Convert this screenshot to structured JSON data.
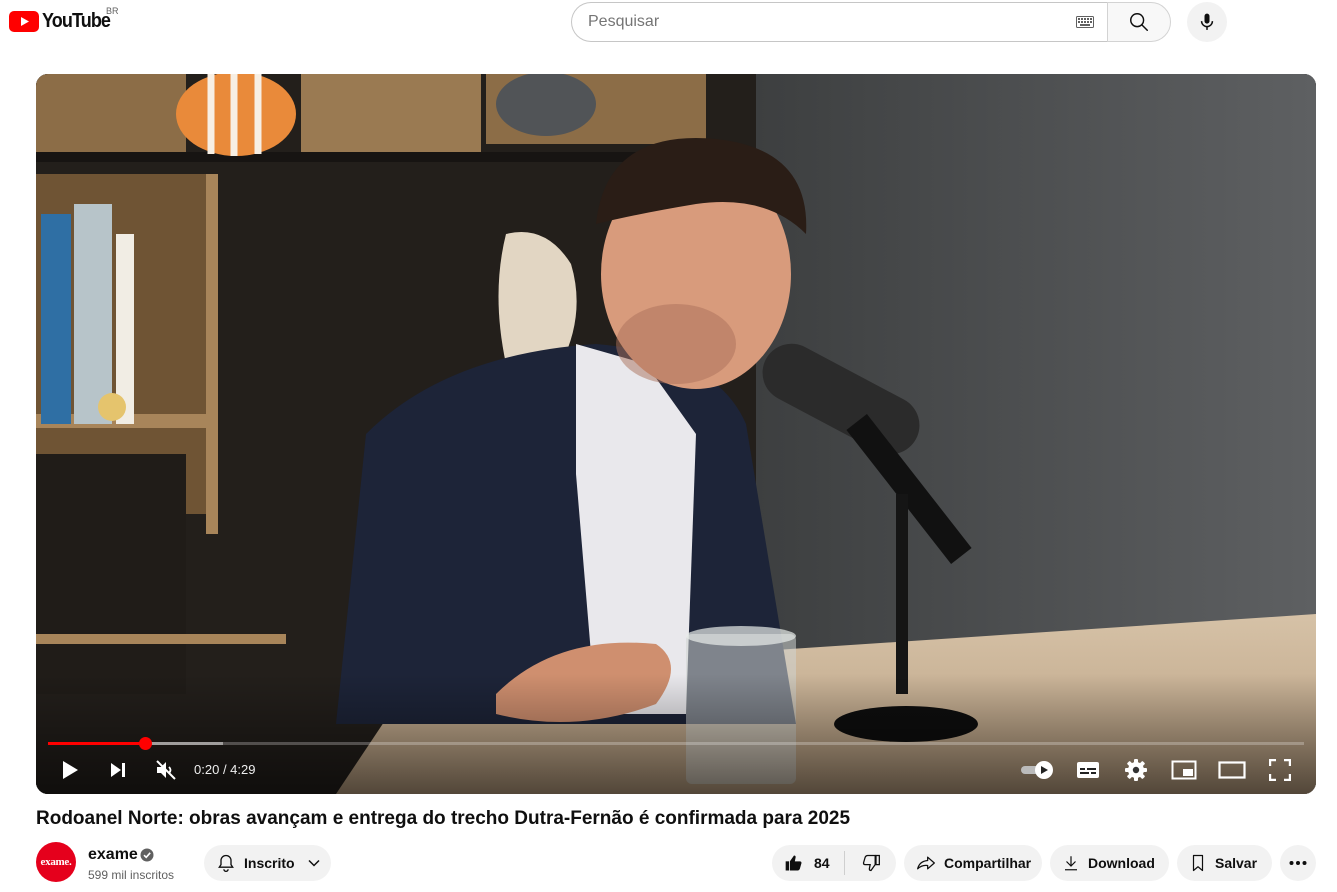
{
  "masthead": {
    "logo_text": "YouTube",
    "country_code": "BR",
    "search_placeholder": "Pesquisar",
    "icons": [
      "youtube-logo-icon",
      "keyboard-icon",
      "search-icon",
      "microphone-icon"
    ]
  },
  "player": {
    "current_time": "0:20",
    "duration": "4:29",
    "time_display": "0:20 / 4:29",
    "progress_played_fraction": 0.0774,
    "progress_buffered_fraction": 0.139,
    "muted": true,
    "autoplay_enabled": true,
    "icons": [
      "play-icon",
      "next-icon",
      "volume-muted-icon",
      "autoplay-toggle-icon",
      "subtitles-icon",
      "settings-gear-icon",
      "miniplayer-icon",
      "theater-mode-icon",
      "fullscreen-icon"
    ]
  },
  "video": {
    "title": "Rodoanel Norte: obras avançam e entrega do trecho Dutra-Fernão é confirmada para 2025"
  },
  "channel": {
    "name": "exame",
    "avatar_text": "exame.",
    "subscribers": "599 mil inscritos",
    "verified": true,
    "subscribe_label": "Inscrito"
  },
  "actions": {
    "like_count": "84",
    "share_label": "Compartilhar",
    "download_label": "Download",
    "save_label": "Salvar"
  },
  "colors": {
    "brand_red": "#ff0000",
    "text_primary": "#0f0f0f",
    "text_secondary": "#606060",
    "pill_background": "#f2f2f2",
    "avatar_red": "#e5001c"
  }
}
